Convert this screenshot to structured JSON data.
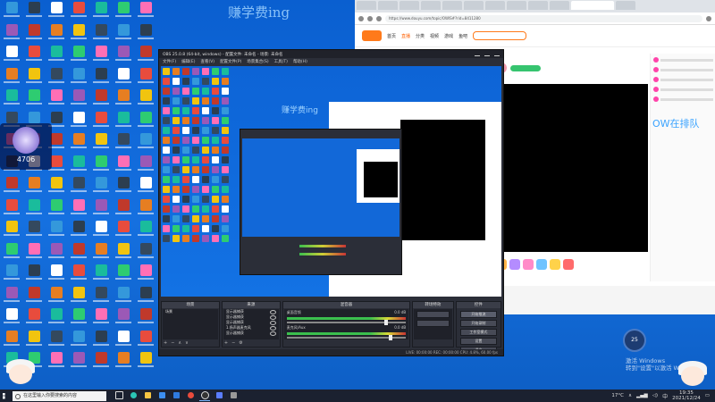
{
  "desktop": {
    "watermark": "赚学费ing",
    "badge_value": "4706"
  },
  "browser": {
    "url": "https://www.douyu.com/topic/OWIS#?rid=8411280",
    "announcement": "OW在排队",
    "nav": [
      "首页",
      "直播",
      "分类",
      "视频",
      "游戏",
      "鱼吧"
    ],
    "follow_label": "关注"
  },
  "obs": {
    "title": "OBS 25.0.8 (64-bit, windows) - 配置文件: 未命名 - 场景: 未命名",
    "menu": [
      "文件(F)",
      "编辑(E)",
      "查看(V)",
      "配置文件(P)",
      "场景集合(S)",
      "工具(T)",
      "帮助(H)"
    ],
    "preview_watermark": "赚学费ing",
    "docks": {
      "scenes": "场景",
      "sources": "来源",
      "mixer": "混音器",
      "transitions": "转场特效",
      "controls": "控件"
    },
    "scene_items": [
      "场景"
    ],
    "source_items": [
      "显示器捕获",
      "显示器捕获",
      "显示器捕获",
      "1.扬声器麦克风",
      "显示器捕获"
    ],
    "mixer_channels": [
      {
        "name": "桌面音频",
        "db": "0.0 dB",
        "level": 0.82
      },
      {
        "name": "麦克风/Aux",
        "db": "0.0 dB",
        "level": 0.86
      }
    ],
    "controls": [
      "开始推流",
      "开始录制",
      "工作室模式",
      "设置",
      "退出"
    ],
    "status": "LIVE: 00:00:00   REC: 00:00:00   CPU: 4.8%, 60.00 fps"
  },
  "tray": {
    "weather_temp": "25",
    "activation_title": "激活 Windows",
    "activation_sub": "转到\"设置\"以激活 Windows。",
    "temperature": "17°C",
    "ime": "中",
    "time": "19:35",
    "date": "2021/12/24"
  },
  "taskbar": {
    "search_placeholder": "在这里输入你要搜索的内容"
  }
}
